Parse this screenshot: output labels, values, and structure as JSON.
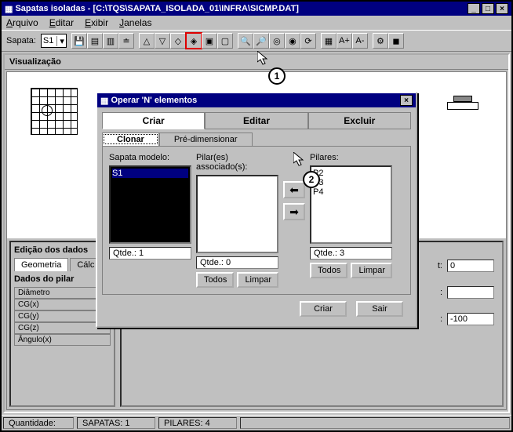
{
  "window": {
    "title": "Sapatas isoladas  -  [C:\\TQS\\SAPATA_ISOLADA_01\\INFRA\\SICMP.DAT]"
  },
  "menu": {
    "file": "Arquivo",
    "edit": "Editar",
    "view": "Exibir",
    "windows": "Janelas"
  },
  "toolbar": {
    "sapata_label": "Sapata:",
    "sapata_value": "S1"
  },
  "viz": {
    "header": "Visualização"
  },
  "editPanel": {
    "title": "Edição dos dados",
    "tab_geo": "Geometria",
    "tab_calc": "Cálc",
    "pilar_title": "Dados do pilar",
    "rows": {
      "diam": "Diâmetro",
      "cgx": "CG(x)",
      "cgy": "CG(y)",
      "cgz": "CG(z)",
      "ang": "Ângulo(x)"
    }
  },
  "rightFields": {
    "f1_label": "t:",
    "f1_value": "0",
    "f2_label": ":",
    "f2_value": "",
    "f3_label": ":",
    "f3_value": "-100"
  },
  "status": {
    "qty_label": "Quantidade:",
    "sapatas": "SAPATAS: 1",
    "pilares": "PILARES: 4"
  },
  "dialog": {
    "title": "Operar 'N' elementos",
    "tabs": {
      "criar": "Criar",
      "editar": "Editar",
      "excluir": "Excluir"
    },
    "subtabs": {
      "clonar": "Clonar",
      "pre": "Pré-dimensionar"
    },
    "cols": {
      "modelo_label": "Sapata modelo:",
      "modelo_items": [
        "S1"
      ],
      "assoc_label": "Pilar(es) associado(s):",
      "assoc_items": [],
      "pilares_label": "Pilares:",
      "pilares_items": [
        "P2",
        "P3",
        "P4"
      ]
    },
    "qtde": {
      "q1": "Qtde.: 1",
      "q2": "Qtde.: 0",
      "q3": "Qtde.: 3"
    },
    "buttons": {
      "todos": "Todos",
      "limpar": "Limpar",
      "criar": "Criar",
      "sair": "Sair"
    },
    "arrows": {
      "left": "⬅",
      "right": "➡"
    }
  },
  "callouts": {
    "c1": "1",
    "c2": "2"
  }
}
